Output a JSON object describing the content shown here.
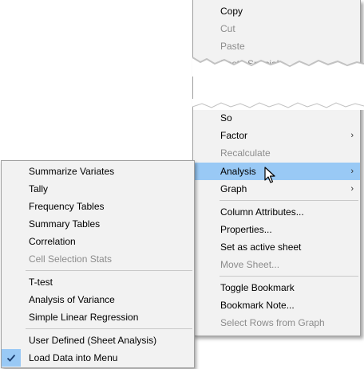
{
  "context_menu": {
    "items": [
      {
        "label": "Copy",
        "enabled": true
      },
      {
        "label": "Cut",
        "enabled": false
      },
      {
        "label": "Paste",
        "enabled": false
      },
      {
        "label": "Paste Special",
        "enabled": false
      },
      {
        "label": "So",
        "enabled": true
      },
      {
        "label": "Factor",
        "enabled": true,
        "submenu": true
      },
      {
        "label": "Recalculate",
        "enabled": false
      },
      {
        "label": "Analysis",
        "enabled": true,
        "submenu": true,
        "highlighted": true
      },
      {
        "label": "Graph",
        "enabled": true,
        "submenu": true
      },
      {
        "label": "Column Attributes...",
        "enabled": true
      },
      {
        "label": "Properties...",
        "enabled": true
      },
      {
        "label": "Set as active sheet",
        "enabled": true
      },
      {
        "label": "Move Sheet...",
        "enabled": false
      },
      {
        "label": "Toggle Bookmark",
        "enabled": true
      },
      {
        "label": "Bookmark Note...",
        "enabled": true
      },
      {
        "label": "Select Rows from Graph",
        "enabled": false
      }
    ]
  },
  "analysis_submenu": {
    "items": [
      {
        "label": "Summarize Variates",
        "enabled": true
      },
      {
        "label": "Tally",
        "enabled": true
      },
      {
        "label": "Frequency Tables",
        "enabled": true
      },
      {
        "label": "Summary Tables",
        "enabled": true
      },
      {
        "label": "Correlation",
        "enabled": true
      },
      {
        "label": "Cell Selection Stats",
        "enabled": false
      },
      {
        "label": "T-test",
        "enabled": true
      },
      {
        "label": "Analysis of Variance",
        "enabled": true
      },
      {
        "label": "Simple Linear Regression",
        "enabled": true
      },
      {
        "label": "User Defined (Sheet Analysis)",
        "enabled": true
      },
      {
        "label": "Load Data into Menu",
        "enabled": true,
        "checked": true
      }
    ]
  },
  "icons": {
    "submenu_arrow": "chevron-right-icon",
    "checkmark": "checkmark-icon",
    "cursor": "mouse-pointer-icon"
  },
  "colors": {
    "menu_background": "#f2f2f2",
    "highlight": "#99c9f5",
    "disabled_text": "#8c8c8c"
  }
}
